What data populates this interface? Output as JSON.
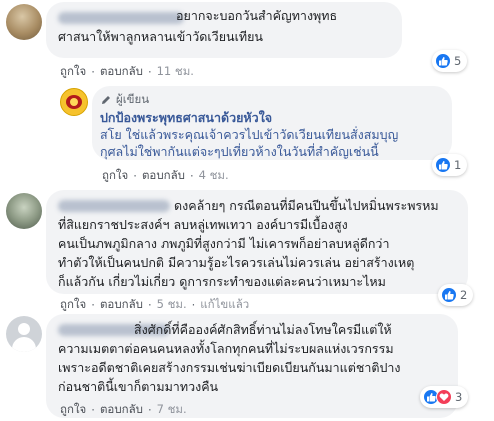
{
  "comments": [
    {
      "lines": [
        "อยากจะบอกวันสำคัญทางพุทธ",
        "ศาสนาให้พาลูกหลานเข้าวัดเวียนเทียน"
      ],
      "actions": {
        "like": "ถูกใจ",
        "reply": "ตอบกลับ",
        "time": "11 ชม."
      },
      "reactions": {
        "icons": [
          "like-icon"
        ],
        "count": "5"
      }
    },
    {
      "author_badge": "ผู้เขียน",
      "name": "ปกป้องพระพุทธศาสนาด้วยหัวใจ",
      "lines": [
        "สโย ใช่แล้วพระคุณเจ้าควรไปเข้าวัดเวียนเทียนสั่งสมบุญ",
        "กุศลไม่ใช่พากันแต่จะๆปเที่ยวห้างในวันที่สำคัญเช่นนี้"
      ],
      "mention": "สโย",
      "actions": {
        "like": "ถูกใจ",
        "reply": "ตอบกลับ",
        "time": "4 ชม."
      },
      "reactions": {
        "icons": [
          "like-icon"
        ],
        "count": "1"
      }
    },
    {
      "lines": [
        "ดงคล้ายๆ กรณีตอนที่มีคนปีนขึ้นไปหมิ่นพระพรหม",
        "ที่สิแยกราชประสงค์ฯ ลบหลู่เทพเทวา องค์บารมีเบื้องสูง",
        "คนเป็นภพภูมิกลาง ภพภูมิที่สูงกว่ามี ไม่เคารพก็อย่าลบหลู่ดีกว่า",
        "ทำตัวให้เป็นคนปกติ มีความรู้อะไรควรเล่นไม่ควรเล่น อย่าสร้างเหตุ",
        "ก็แล้วกัน เกี่ยวไม่เกี่ยว ดูการกระทำของแต่ละคนว่าเหมาะไหม"
      ],
      "actions": {
        "like": "ถูกใจ",
        "reply": "ตอบกลับ",
        "time": "5 ชม.",
        "edited": "แก้ไขแล้ว"
      },
      "reactions": {
        "icons": [
          "like-icon"
        ],
        "count": "2"
      }
    },
    {
      "lines": [
        "สิ่งศักดิ์ที่คือองค์ศักสิทธิ์ท่านไม่ลงโทษใครมีแต่ให้",
        "ความเมตตาต่อคนคนหลงทั้งโลกทุกคนที่ไม่ระบผลแห่งเวรกรรม",
        "เพราะอดีตชาติเคยสร้างกรรมเช่นฆ่าเบียดเบียนกันมาแต่ชาติปาง",
        "ก่อนชาตินี้เขาก็ตามมาทวงคืน"
      ],
      "actions": {
        "like": "ถูกใจ",
        "reply": "ตอบกลับ",
        "time": "7 ชม."
      },
      "reactions": {
        "icons": [
          "like-icon",
          "love-icon"
        ],
        "count": "3"
      }
    }
  ],
  "colors": {
    "link": "#385898",
    "like": "#1877f2",
    "love": "#f33e58",
    "bubble": "#f2f3f5"
  }
}
